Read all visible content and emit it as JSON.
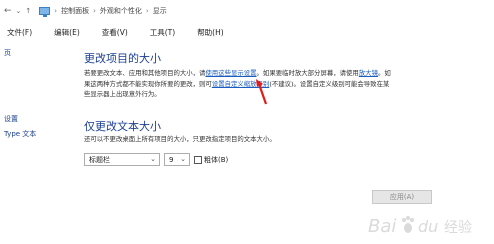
{
  "addressbar": {
    "back_arrow": "←",
    "crumbs": [
      "控制面板",
      "外观和个性化",
      "显示"
    ]
  },
  "menubar": {
    "items": [
      "文件(F)",
      "编辑(E)",
      "查看(V)",
      "工具(T)",
      "帮助(H)"
    ]
  },
  "leftpane": {
    "items": [
      "页",
      "设置",
      "Type 文本"
    ]
  },
  "section1": {
    "heading": "更改项目的大小",
    "line1_a": "若要更改文本、应用和其他项目的大小，请",
    "line1_link1": "使用这些显示设置",
    "line1_b": "。如果要临时放大部分屏幕，请使用",
    "line1_link2": "放大镜",
    "line1_c": "。如",
    "line2_a": "果这两种方式都不能实现你所要的更改，则可",
    "line2_link": "设置自定义缩放级别",
    "line2_b": "(不建议)。设置自定义级别可能会导致在某",
    "line3": "些显示器上出现意外行为。"
  },
  "section2": {
    "heading": "仅更改文本大小",
    "description": "还可以不更改桌面上所有项目的大小，只更改指定项目的文本大小。",
    "item_select": "标题栏",
    "size_select": "9",
    "bold_label": "粗体(B)",
    "bold_checked": false
  },
  "apply_button": "应用(A)",
  "watermark": "Baidu 经验"
}
